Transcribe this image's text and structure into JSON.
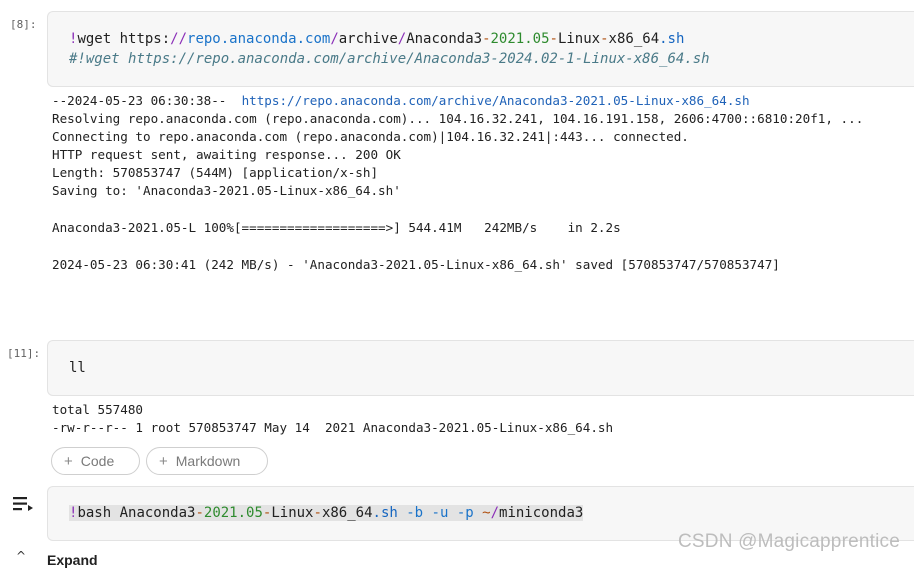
{
  "cells": [
    {
      "exec_label": "[8]:",
      "code": {
        "prefix": "!",
        "cmd": "wget https:",
        "url_sep": "//",
        "host": "repo.anaconda.com",
        "slash1": "/",
        "path1": "archive",
        "slash2": "/",
        "name_a": "Anaconda3",
        "dash1": "-",
        "ver": "2021.05",
        "dash2": "-",
        "name_b": "Linux",
        "dash3": "-",
        "name_c": "x86_64",
        "ext": ".sh",
        "comment": "#!wget https://repo.anaconda.com/archive/Anaconda3-2024.02-1-Linux-x86_64.sh"
      },
      "output": {
        "l1_pre": "--2024-05-23 06:30:38--  ",
        "l1_link": "https://repo.anaconda.com/archive/Anaconda3-2021.05-Linux-x86_64.sh",
        "l2": "Resolving repo.anaconda.com (repo.anaconda.com)... 104.16.32.241, 104.16.191.158, 2606:4700::6810:20f1, ...",
        "l3": "Connecting to repo.anaconda.com (repo.anaconda.com)|104.16.32.241|:443... connected.",
        "l4": "HTTP request sent, awaiting response... 200 OK",
        "l5": "Length: 570853747 (544M) [application/x-sh]",
        "l6": "Saving to: 'Anaconda3-2021.05-Linux-x86_64.sh'",
        "l7": "Anaconda3-2021.05-L 100%[===================>] 544.41M   242MB/s    in 2.2s",
        "l8": "2024-05-23 06:30:41 (242 MB/s) - 'Anaconda3-2021.05-Linux-x86_64.sh' saved [570853747/570853747]"
      }
    },
    {
      "exec_label": "[11]:",
      "code": {
        "text": "ll"
      },
      "output": {
        "l1": "total 557480",
        "l2": "-rw-r--r-- 1 root 570853747 May 14  2021 Anaconda3-2021.05-Linux-x86_64.sh"
      }
    },
    {
      "code": {
        "prefix": "!",
        "cmd": "bash Anaconda3",
        "dash1": "-",
        "ver": "2021.05",
        "dash2": "-",
        "name_b": "Linux",
        "dash3": "-",
        "name_c": "x86_64",
        "ext": ".sh",
        "sp1": " ",
        "f1": "-b",
        "sp2": " ",
        "f2": "-u",
        "sp3": " ",
        "f3": "-p",
        "sp4": " ",
        "tilde": "~",
        "slash": "/",
        "dir": "miniconda3"
      }
    }
  ],
  "toolbar": {
    "code_label": "Code",
    "markdown_label": "Markdown",
    "plus": "+"
  },
  "footer": {
    "expand_label": "Expand",
    "caret": "^"
  },
  "watermark": "CSDN @Magicapprentice",
  "icons": {
    "run": "run-cell-icon",
    "caret": "chevron-up-icon"
  }
}
